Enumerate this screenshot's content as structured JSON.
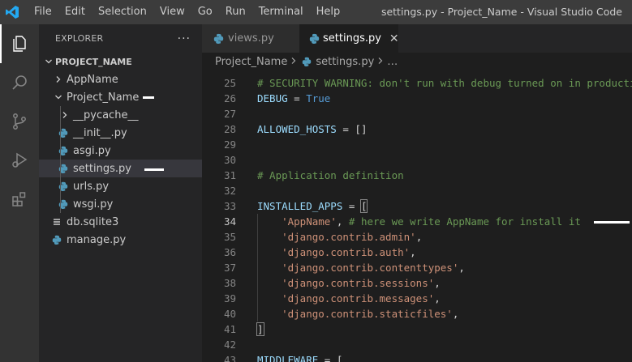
{
  "titlebar": {
    "menu": [
      "File",
      "Edit",
      "Selection",
      "View",
      "Go",
      "Run",
      "Terminal",
      "Help"
    ],
    "window_title": "settings.py - Project_Name - Visual Studio Code"
  },
  "activitybar": {
    "icons": [
      "explorer-icon",
      "search-icon",
      "source-control-icon",
      "run-debug-icon",
      "extensions-icon"
    ]
  },
  "sidebar": {
    "title": "EXPLORER",
    "more": "···",
    "project": "PROJECT_NAME",
    "items": [
      {
        "label": "AppName",
        "kind": "folder",
        "expanded": false
      },
      {
        "label": "Project_Name",
        "kind": "folder",
        "expanded": true
      },
      {
        "label": "__pycache__",
        "kind": "folder",
        "expanded": false
      },
      {
        "label": "__init__.py",
        "kind": "python"
      },
      {
        "label": "asgi.py",
        "kind": "python"
      },
      {
        "label": "settings.py",
        "kind": "python",
        "selected": true
      },
      {
        "label": "urls.py",
        "kind": "python"
      },
      {
        "label": "wsgi.py",
        "kind": "python"
      },
      {
        "label": "db.sqlite3",
        "kind": "database"
      },
      {
        "label": "manage.py",
        "kind": "python"
      }
    ]
  },
  "tabs": [
    {
      "label": "views.py",
      "active": false
    },
    {
      "label": "settings.py",
      "active": true,
      "close": "✕"
    }
  ],
  "breadcrumbs": {
    "folder": "Project_Name",
    "file": "settings.py",
    "more": "…"
  },
  "code": {
    "current_line": 34,
    "lines": [
      {
        "n": "25",
        "tokens": [
          [
            "# SECURITY WARNING: don't run with debug turned on in production!",
            "comment"
          ]
        ]
      },
      {
        "n": "26",
        "tokens": [
          [
            "DEBUG",
            "var"
          ],
          [
            " = ",
            "op"
          ],
          [
            "True",
            "kw"
          ]
        ]
      },
      {
        "n": "27",
        "tokens": []
      },
      {
        "n": "28",
        "tokens": [
          [
            "ALLOWED_HOSTS",
            "var"
          ],
          [
            " = ",
            "op"
          ],
          [
            "[]",
            "plain"
          ]
        ]
      },
      {
        "n": "29",
        "tokens": []
      },
      {
        "n": "30",
        "tokens": []
      },
      {
        "n": "31",
        "tokens": [
          [
            "# Application definition",
            "comment"
          ]
        ]
      },
      {
        "n": "32",
        "tokens": []
      },
      {
        "n": "33",
        "tokens": [
          [
            "INSTALLED_APPS",
            "var"
          ],
          [
            " = ",
            "op"
          ],
          [
            "[",
            "bracket"
          ]
        ]
      },
      {
        "n": "34",
        "tokens": [
          [
            "    ",
            "plain"
          ],
          [
            "'AppName'",
            "str"
          ],
          [
            ", ",
            "plain"
          ],
          [
            "# here we write AppName for install it",
            "comment"
          ]
        ]
      },
      {
        "n": "35",
        "tokens": [
          [
            "    ",
            "plain"
          ],
          [
            "'django.contrib.admin'",
            "str"
          ],
          [
            ",",
            "plain"
          ]
        ]
      },
      {
        "n": "36",
        "tokens": [
          [
            "    ",
            "plain"
          ],
          [
            "'django.contrib.auth'",
            "str"
          ],
          [
            ",",
            "plain"
          ]
        ]
      },
      {
        "n": "37",
        "tokens": [
          [
            "    ",
            "plain"
          ],
          [
            "'django.contrib.contenttypes'",
            "str"
          ],
          [
            ",",
            "plain"
          ]
        ]
      },
      {
        "n": "38",
        "tokens": [
          [
            "    ",
            "plain"
          ],
          [
            "'django.contrib.sessions'",
            "str"
          ],
          [
            ",",
            "plain"
          ]
        ]
      },
      {
        "n": "39",
        "tokens": [
          [
            "    ",
            "plain"
          ],
          [
            "'django.contrib.messages'",
            "str"
          ],
          [
            ",",
            "plain"
          ]
        ]
      },
      {
        "n": "40",
        "tokens": [
          [
            "    ",
            "plain"
          ],
          [
            "'django.contrib.staticfiles'",
            "str"
          ],
          [
            ",",
            "plain"
          ]
        ]
      },
      {
        "n": "41",
        "tokens": [
          [
            "]",
            "bracket"
          ]
        ]
      },
      {
        "n": "42",
        "tokens": []
      },
      {
        "n": "43",
        "tokens": [
          [
            "MIDDLEWARE",
            "var"
          ],
          [
            " = ",
            "op"
          ],
          [
            "[",
            "plain"
          ]
        ]
      }
    ]
  },
  "colors": {
    "accent": "#007acc",
    "python_icon": "#519aba",
    "comment": "#6a9955",
    "string": "#ce9178",
    "keyword": "#569cd6",
    "variable": "#9cdcfe"
  }
}
